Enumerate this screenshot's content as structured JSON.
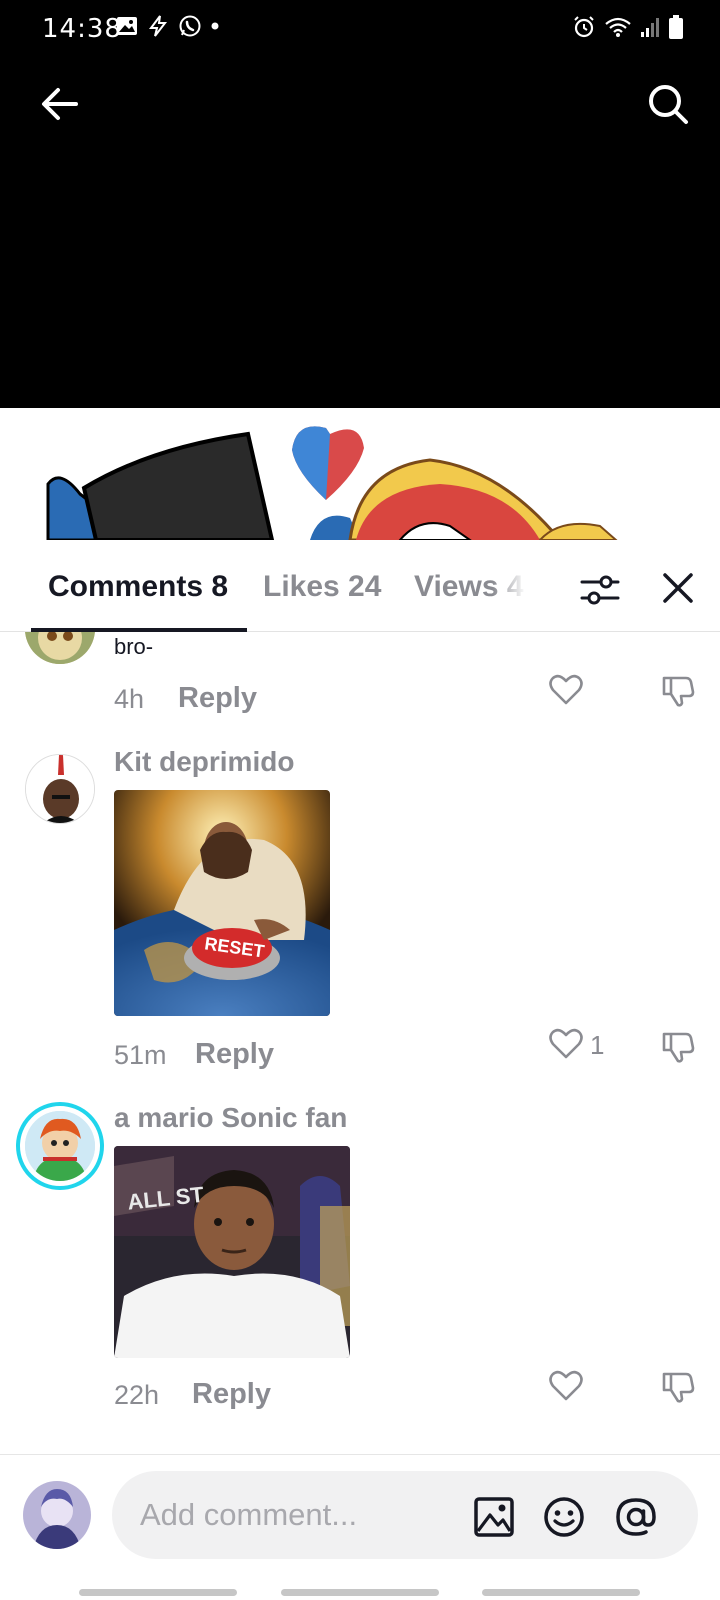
{
  "status_bar": {
    "time": "14:38",
    "left_icons": [
      "gallery-icon",
      "flash-icon",
      "whatsapp-icon",
      "dot-icon"
    ],
    "right_icons": [
      "alarm-icon",
      "wifi-icon",
      "signal-icon",
      "battery-icon"
    ]
  },
  "nav": {
    "back_icon": "arrow-left-icon",
    "search_icon": "search-icon"
  },
  "tabs": {
    "comments_label": "Comments 8",
    "likes_label": "Likes 24",
    "views_label": "Views 4",
    "filter_icon": "sliders-icon",
    "close_icon": "close-icon"
  },
  "comments": [
    {
      "text": "bro-",
      "time": "4h",
      "reply_label": "Reply"
    },
    {
      "username": "Kit deprimido",
      "time": "51m",
      "reply_label": "Reply",
      "like_count": "1"
    },
    {
      "username": "a mario Sonic fan",
      "time": "22h",
      "reply_label": "Reply"
    }
  ],
  "composer": {
    "placeholder": "Add comment...",
    "image_icon": "image-icon",
    "emoji_icon": "emoji-icon",
    "mention_icon": "at-icon"
  },
  "colors": {
    "text_primary": "#161823",
    "text_secondary": "#8a8b91",
    "input_bg": "#f1f1f2",
    "avatar_ring": "#20d5ec"
  }
}
